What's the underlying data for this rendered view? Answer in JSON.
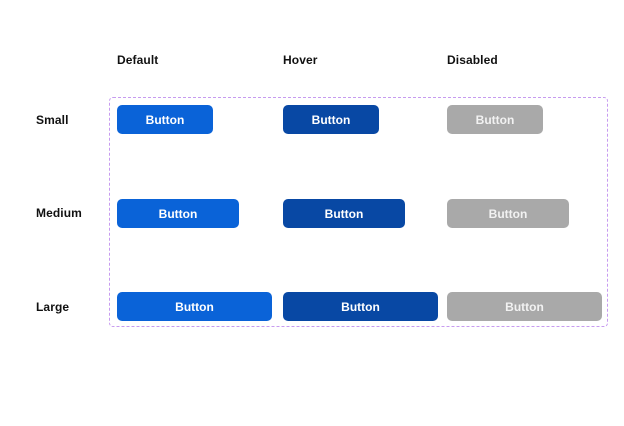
{
  "columns": {
    "default": "Default",
    "hover": "Hover",
    "disabled": "Disabled"
  },
  "rows": {
    "small": "Small",
    "medium": "Medium",
    "large": "Large"
  },
  "buttons": {
    "label": "Button"
  },
  "colors": {
    "default": "#0a63d8",
    "hover": "#0848a4",
    "disabled": "#a9a9a9",
    "frame_border": "#c79bf0"
  }
}
